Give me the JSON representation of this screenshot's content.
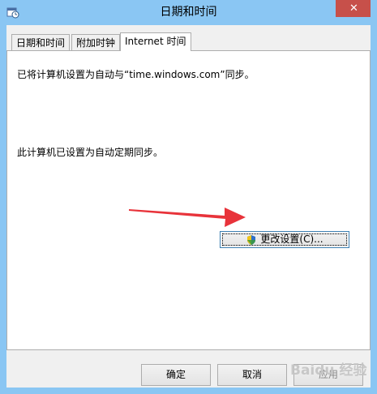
{
  "window": {
    "title": "日期和时间",
    "close_label": "✕"
  },
  "tabs": [
    {
      "label": "日期和时间",
      "active": false
    },
    {
      "label": "附加时钟",
      "active": false
    },
    {
      "label": "Internet 时间",
      "active": true
    }
  ],
  "panel": {
    "sync_info": "已将计算机设置为自动与“time.windows.com”同步。",
    "schedule_info": "此计算机已设置为自动定期同步。",
    "change_settings_label": "更改设置(C)..."
  },
  "buttons": {
    "ok_label": "确定",
    "cancel_label": "取消",
    "apply_label": "应用"
  },
  "watermark": {
    "text": "Baidu 经验"
  },
  "colors": {
    "frame": "#8ac6f3",
    "close": "#c7504a",
    "arrow": "#e8333a"
  }
}
